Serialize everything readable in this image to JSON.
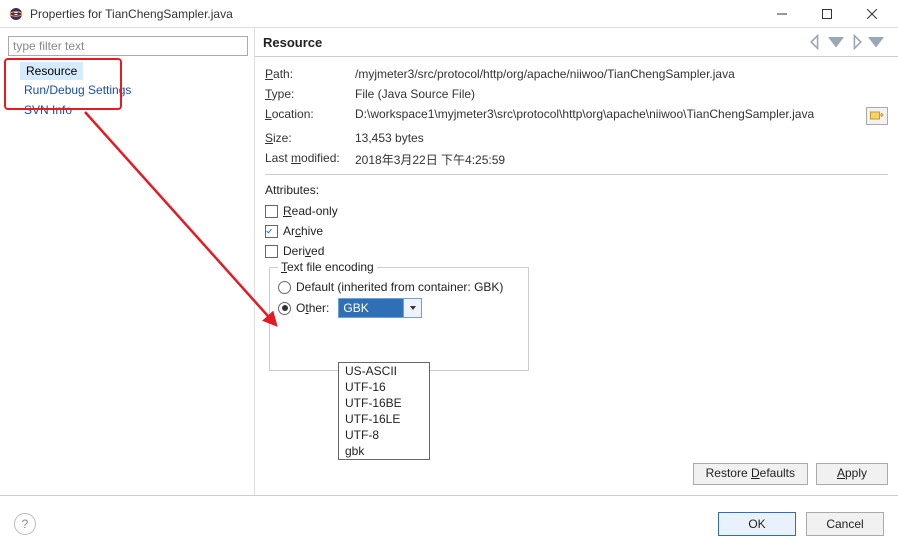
{
  "window": {
    "title": "Properties for TianChengSampler.java"
  },
  "filter": {
    "placeholder": "type filter text"
  },
  "tree": {
    "resource": "Resource",
    "run_debug": "Run/Debug Settings",
    "svn_info": "SVN Info"
  },
  "header": {
    "title": "Resource"
  },
  "props": {
    "path_label": "Path:",
    "path": "/myjmeter3/src/protocol/http/org/apache/niiwoo/TianChengSampler.java",
    "type_label": "Type:",
    "type": "File  (Java Source File)",
    "location_label": "Location:",
    "location": "D:\\workspace1\\myjmeter3\\src\\protocol\\http\\org\\apache\\niiwoo\\TianChengSampler.java",
    "size_label": "Size:",
    "size": "13,453  bytes",
    "last_modified_label": "Last modified:",
    "last_modified": "2018年3月22日 下午4:25:59"
  },
  "attributes": {
    "title": "Attributes:",
    "read_only": "Read-only",
    "archive": "Archive",
    "derived": "Derived"
  },
  "encoding": {
    "legend": "Text file encoding",
    "default_label": "Default (inherited from container: GBK)",
    "other_label": "Other:",
    "value": "GBK",
    "options": [
      "US-ASCII",
      "UTF-16",
      "UTF-16BE",
      "UTF-16LE",
      "UTF-8",
      "gbk"
    ]
  },
  "buttons": {
    "restore": "Restore Defaults",
    "apply": "Apply",
    "ok": "OK",
    "cancel": "Cancel"
  }
}
